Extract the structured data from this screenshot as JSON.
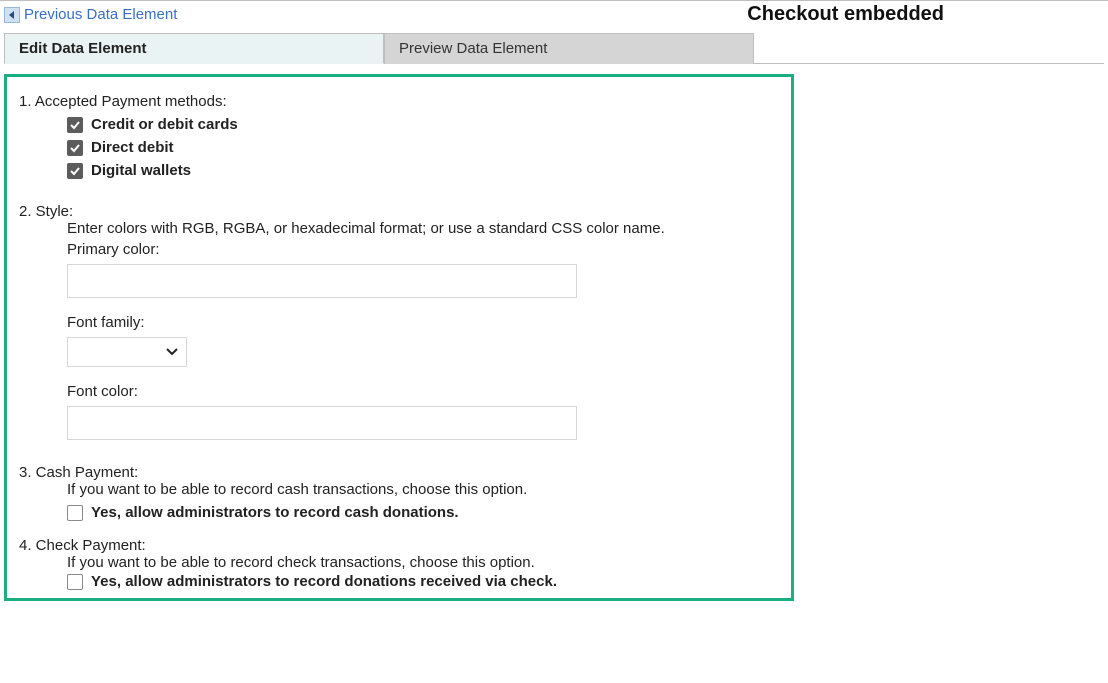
{
  "header": {
    "prev_label": "Previous Data Element",
    "page_title": "Checkout embedded"
  },
  "tabs": {
    "edit": "Edit Data Element",
    "preview": "Preview Data Element"
  },
  "section1": {
    "title": "1. Accepted Payment methods:",
    "options": [
      {
        "label": "Credit or debit cards",
        "checked": true
      },
      {
        "label": "Direct debit",
        "checked": true
      },
      {
        "label": "Digital wallets",
        "checked": true
      }
    ]
  },
  "section2": {
    "title": "2. Style:",
    "hint": "Enter colors with RGB, RGBA, or hexadecimal format; or use a standard CSS color name.",
    "primary_label": "Primary color:",
    "primary_value": "",
    "fontfamily_label": "Font family:",
    "fontfamily_value": "",
    "fontcolor_label": "Font color:",
    "fontcolor_value": ""
  },
  "section3": {
    "title": "3. Cash Payment:",
    "hint": "If you want to be able to record cash transactions, choose this option.",
    "option_label": "Yes, allow administrators to record cash donations.",
    "option_checked": false
  },
  "section4": {
    "title": "4. Check Payment:",
    "hint": "If you want to be able to record check transactions, choose this option.",
    "option_label": "Yes, allow administrators to record donations received via check.",
    "option_checked": false
  }
}
